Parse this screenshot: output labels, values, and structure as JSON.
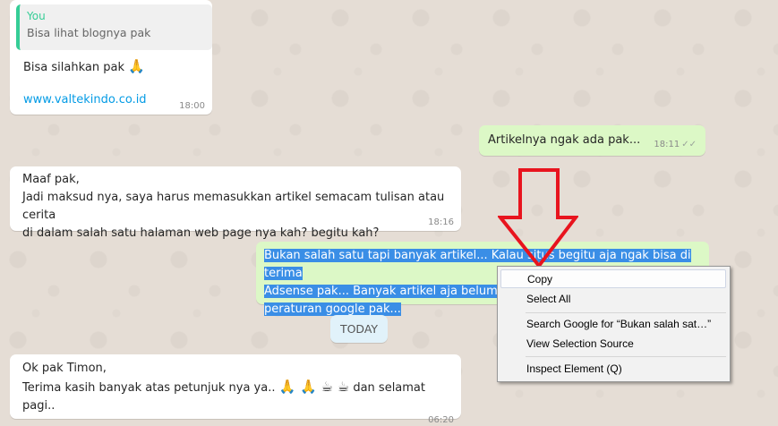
{
  "messages": {
    "m1": {
      "quote_author": "You",
      "quote_text": "Bisa lihat blognya pak",
      "text": "Bisa silahkan pak",
      "emoji": "🙏",
      "link": "www.valtekindo.co.id",
      "time": "18:00"
    },
    "m2": {
      "text": "Artikelnya ngak ada pak...",
      "time": "18:11",
      "ticks": "✓✓"
    },
    "m3": {
      "line1": "Maaf pak,",
      "line2": "Jadi maksud nya, saya harus memasukkan artikel semacam tulisan atau cerita",
      "line3": "di dalam salah satu halaman web page nya kah? begitu kah?",
      "time": "18:16"
    },
    "m4": {
      "line1": "Bukan salah satu tapi banyak artikel... Kalau situs begitu aja ngak bisa di terima",
      "line2": "Adsense pak... Banyak artikel aja belum ter",
      "line3": "peraturan google pak..."
    },
    "m5": {
      "line1": "Ok pak Timon,",
      "line2": "Terima kasih banyak atas petunjuk nya ya..",
      "line2_emoji": "🙏 🙏 ☕ ☕",
      "line2_tail": "dan selamat pagi..",
      "time": "06:20"
    }
  },
  "date_divider": "TODAY",
  "context_menu": {
    "items": [
      {
        "label": "Copy"
      },
      {
        "label": "Select All"
      },
      {
        "label": "Search Google for “Bukan salah sat…”"
      },
      {
        "label": "View Selection Source"
      },
      {
        "label": "Inspect Element (Q)"
      }
    ]
  },
  "colors": {
    "background": "#e5ddd5",
    "incoming": "#ffffff",
    "outgoing": "#dcf8c6",
    "selection": "#3a8ee6",
    "arrow": "#e8141e",
    "quote_accent": "#35cd96",
    "link": "#039be5"
  }
}
